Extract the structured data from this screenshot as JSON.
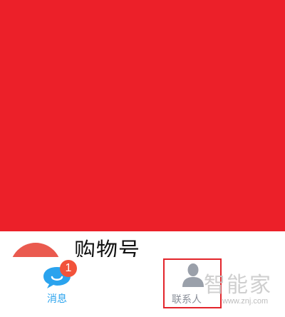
{
  "list": {
    "first_item_title": "购物号"
  },
  "tabbar": {
    "messages": {
      "label": "消息",
      "badge": "1",
      "icon": "chat-bubble-icon",
      "color": "#2aa3ee"
    },
    "contacts": {
      "label": "联系人",
      "icon": "person-icon",
      "color": "#8a8f99"
    }
  },
  "watermark": {
    "logo_text": "智能家",
    "url": "www.znj.com"
  },
  "colors": {
    "banner": "#ec2029",
    "highlight_box": "#e3242b",
    "badge": "#f2533b"
  }
}
